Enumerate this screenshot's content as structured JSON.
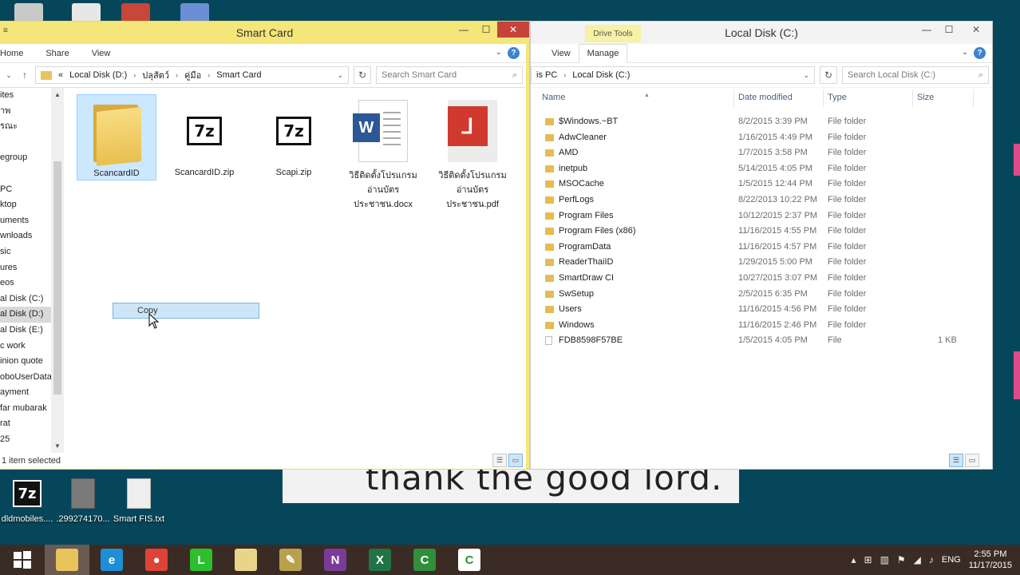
{
  "desktop": {
    "icons": [
      {
        "label": "dldmobiles....",
        "icon": "7zip-archive-icon"
      },
      {
        "label": ".299274170...",
        "icon": "blank-file-icon"
      },
      {
        "label": "Smart FIS.txt",
        "icon": "text-file-icon"
      }
    ],
    "banner_text": "thank the good lord."
  },
  "left_window": {
    "title": "Smart Card",
    "ribbon_tabs": [
      "Home",
      "Share",
      "View"
    ],
    "address": {
      "back": "«",
      "parts": [
        "Local Disk (D:)",
        "ปลุสัตว์",
        "คู่มือ",
        "Smart Card"
      ]
    },
    "search_placeholder": "Search Smart Card",
    "nav_items": [
      "ites",
      "าพ",
      "รณะ",
      "",
      "egroup",
      "",
      "PC",
      "ktop",
      "uments",
      "wnloads",
      "sic",
      "ures",
      "eos",
      "al Disk (C:)",
      "al Disk (D:)",
      "al Disk (E:)",
      "c work",
      "inion quote",
      "oboUserData",
      "ayment",
      "far mubarak",
      "rat",
      "25"
    ],
    "files": [
      {
        "name": "ScancardID",
        "type": "folder"
      },
      {
        "name": "ScancardID.zip",
        "type": "7z"
      },
      {
        "name": "Scapi.zip",
        "type": "7z"
      },
      {
        "name": "วิธีติดตั้งโปรแกรมอ่านบัตรประชาชน.docx",
        "type": "word"
      },
      {
        "name": "วิธีติดตั้งโปรแกรมอ่านบัตรประชาชน.pdf",
        "type": "pdf"
      }
    ],
    "drag_label": "Copy",
    "status": "1 item selected"
  },
  "right_window": {
    "title": "Local Disk (C:)",
    "context_tab": "Drive Tools",
    "ribbon_tabs": [
      "View",
      "Manage"
    ],
    "address": {
      "parts": [
        "is PC",
        "Local Disk (C:)"
      ]
    },
    "search_placeholder": "Search Local Disk (C:)",
    "columns": [
      "Name",
      "Date modified",
      "Type",
      "Size"
    ],
    "rows": [
      {
        "name": "$Windows.~BT",
        "date": "8/2/2015 3:39 PM",
        "type": "File folder",
        "size": "",
        "kind": "folder"
      },
      {
        "name": "AdwCleaner",
        "date": "1/16/2015 4:49 PM",
        "type": "File folder",
        "size": "",
        "kind": "folder"
      },
      {
        "name": "AMD",
        "date": "1/7/2015 3:58 PM",
        "type": "File folder",
        "size": "",
        "kind": "folder"
      },
      {
        "name": "inetpub",
        "date": "5/14/2015 4:05 PM",
        "type": "File folder",
        "size": "",
        "kind": "folder"
      },
      {
        "name": "MSOCache",
        "date": "1/5/2015 12:44 PM",
        "type": "File folder",
        "size": "",
        "kind": "folder"
      },
      {
        "name": "PerfLogs",
        "date": "8/22/2013 10:22 PM",
        "type": "File folder",
        "size": "",
        "kind": "folder"
      },
      {
        "name": "Program Files",
        "date": "10/12/2015 2:37 PM",
        "type": "File folder",
        "size": "",
        "kind": "folder"
      },
      {
        "name": "Program Files (x86)",
        "date": "11/16/2015 4:55 PM",
        "type": "File folder",
        "size": "",
        "kind": "folder"
      },
      {
        "name": "ProgramData",
        "date": "11/16/2015 4:57 PM",
        "type": "File folder",
        "size": "",
        "kind": "folder"
      },
      {
        "name": "ReaderThaiID",
        "date": "1/29/2015 5:00 PM",
        "type": "File folder",
        "size": "",
        "kind": "folder"
      },
      {
        "name": "SmartDraw CI",
        "date": "10/27/2015 3:07 PM",
        "type": "File folder",
        "size": "",
        "kind": "folder"
      },
      {
        "name": "SwSetup",
        "date": "2/5/2015 6:35 PM",
        "type": "File folder",
        "size": "",
        "kind": "folder"
      },
      {
        "name": "Users",
        "date": "11/16/2015 4:56 PM",
        "type": "File folder",
        "size": "",
        "kind": "folder"
      },
      {
        "name": "Windows",
        "date": "11/16/2015 2:46 PM",
        "type": "File folder",
        "size": "",
        "kind": "folder"
      },
      {
        "name": "FDB8598F57BE",
        "date": "1/5/2015 4:05 PM",
        "type": "File",
        "size": "1 KB",
        "kind": "file"
      }
    ]
  },
  "taskbar": {
    "apps": [
      {
        "name": "file-explorer-icon",
        "color": "#e8c45a",
        "glyph": ""
      },
      {
        "name": "internet-explorer-icon",
        "color": "#1e8fd6",
        "glyph": "e"
      },
      {
        "name": "chrome-icon",
        "color": "#db4437",
        "glyph": "●"
      },
      {
        "name": "line-icon",
        "color": "#2bc02b",
        "glyph": "L"
      },
      {
        "name": "folder-icon",
        "color": "#e8d58a",
        "glyph": ""
      },
      {
        "name": "tools-icon",
        "color": "#b8a14e",
        "glyph": "✎"
      },
      {
        "name": "onenote-icon",
        "color": "#7a3a9a",
        "glyph": "N"
      },
      {
        "name": "excel-icon",
        "color": "#217346",
        "glyph": "X"
      },
      {
        "name": "camtasia-icon",
        "color": "#2f8f3a",
        "glyph": "C"
      },
      {
        "name": "camtasia-recorder-icon",
        "color": "#ffffff",
        "glyph": "C"
      }
    ],
    "lang": "ENG",
    "time": "2:55 PM",
    "date": "11/17/2015"
  }
}
